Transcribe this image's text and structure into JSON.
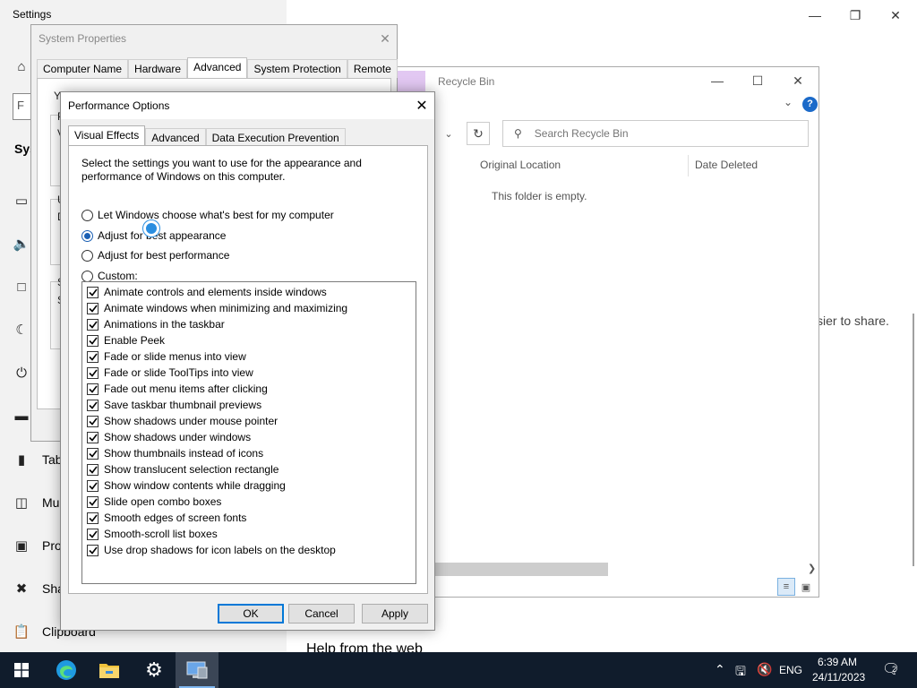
{
  "settings": {
    "title": "Settings",
    "heading_fragment": "Sys",
    "search_fragment": "F",
    "nav_fragments": [
      "Tab",
      "Mu",
      "Pro",
      "Sha",
      "Clipboard"
    ],
    "right_fragment": "sier to share.",
    "bottom_fragment": "Help from the web"
  },
  "explorer": {
    "title": "Recycle Bin",
    "search_placeholder": "Search Recycle Bin",
    "columns": [
      "Original Location",
      "Date Deleted"
    ],
    "empty_message": "This folder is empty.",
    "help_label": "?"
  },
  "system_properties": {
    "title": "System Properties",
    "tabs": [
      "Computer Name",
      "Hardware",
      "Advanced",
      "System Protection",
      "Remote"
    ],
    "active_tab": "Advanced",
    "frag_top": "Yo",
    "frag_p": "P",
    "frag_v": "V",
    "frag_u": "U",
    "frag_d": "D",
    "frag_s": "S",
    "frag_s2": "S"
  },
  "performance_options": {
    "title": "Performance Options",
    "tabs": [
      "Visual Effects",
      "Advanced",
      "Data Execution Prevention"
    ],
    "active_tab": "Visual Effects",
    "description": "Select the settings you want to use for the appearance and performance of Windows on this computer.",
    "radios": [
      {
        "label": "Let Windows choose what's best for my computer",
        "checked": false
      },
      {
        "label": "Adjust for best appearance",
        "checked": true
      },
      {
        "label": "Adjust for best performance",
        "checked": false
      },
      {
        "label": "Custom:",
        "checked": false
      }
    ],
    "effects": [
      {
        "label": "Animate controls and elements inside windows",
        "checked": true
      },
      {
        "label": "Animate windows when minimizing and maximizing",
        "checked": true
      },
      {
        "label": "Animations in the taskbar",
        "checked": true
      },
      {
        "label": "Enable Peek",
        "checked": true
      },
      {
        "label": "Fade or slide menus into view",
        "checked": true
      },
      {
        "label": "Fade or slide ToolTips into view",
        "checked": true
      },
      {
        "label": "Fade out menu items after clicking",
        "checked": true
      },
      {
        "label": "Save taskbar thumbnail previews",
        "checked": true
      },
      {
        "label": "Show shadows under mouse pointer",
        "checked": true
      },
      {
        "label": "Show shadows under windows",
        "checked": true
      },
      {
        "label": "Show thumbnails instead of icons",
        "checked": true
      },
      {
        "label": "Show translucent selection rectangle",
        "checked": true
      },
      {
        "label": "Show window contents while dragging",
        "checked": true
      },
      {
        "label": "Slide open combo boxes",
        "checked": true
      },
      {
        "label": "Smooth edges of screen fonts",
        "checked": true
      },
      {
        "label": "Smooth-scroll list boxes",
        "checked": true
      },
      {
        "label": "Use drop shadows for icon labels on the desktop",
        "checked": true
      }
    ],
    "buttons": {
      "ok": "OK",
      "cancel": "Cancel",
      "apply": "Apply"
    }
  },
  "taskbar": {
    "language": "ENG",
    "time": "6:39 AM",
    "date": "24/11/2023",
    "notification_count": "2"
  },
  "colors": {
    "accent": "#0078d7",
    "taskbar": "#101c2c",
    "radio_selected": "#1a5fb4"
  }
}
